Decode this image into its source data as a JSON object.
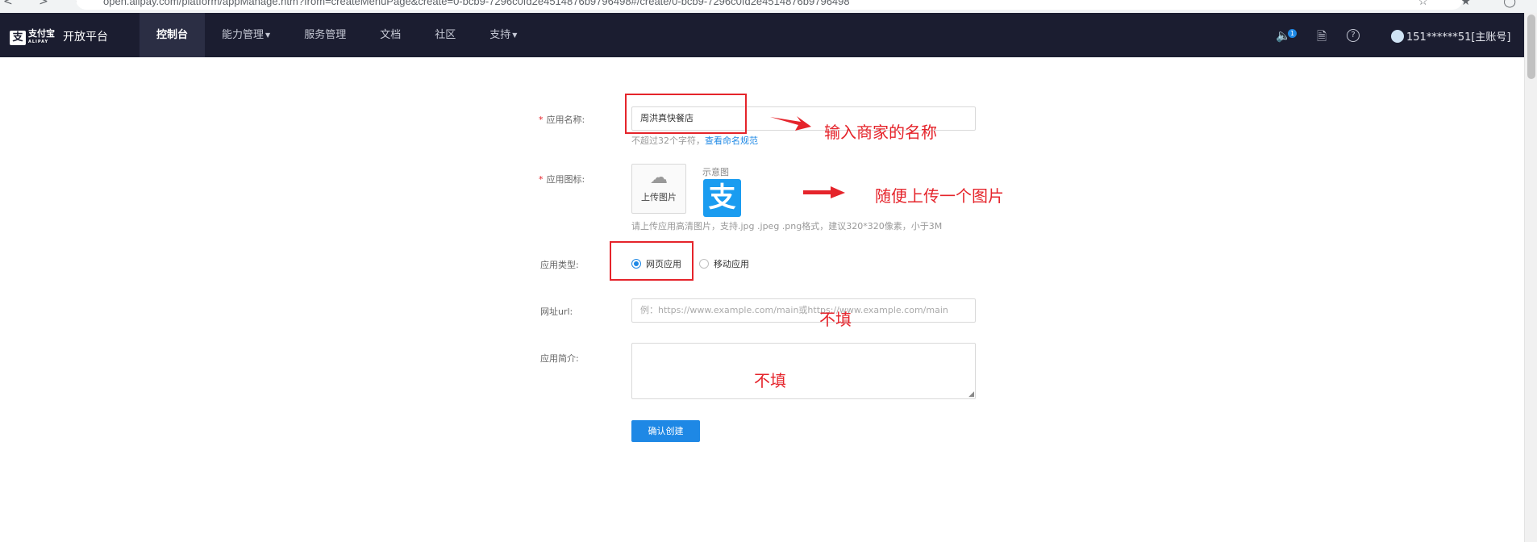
{
  "browser": {
    "url": "open.alipay.com/platform/appManage.htm?from=createMenuPage&create=0-bcb9-7296c0fd2e4514876b9796498#/create/0-bcb9-7296c0fd2e4514876b9796498"
  },
  "nav": {
    "logo_cn": "支付宝",
    "logo_en": "ALIPAY",
    "platform": "开放平台",
    "items": [
      {
        "label": "控制台",
        "active": true
      },
      {
        "label": "能力管理",
        "dropdown": true
      },
      {
        "label": "服务管理"
      },
      {
        "label": "文档"
      },
      {
        "label": "社区"
      },
      {
        "label": "支持",
        "dropdown": true
      }
    ],
    "notification_count": "1",
    "user": "151******51[主账号]",
    "icons": [
      "speaker-icon",
      "document-icon",
      "help-icon"
    ]
  },
  "form": {
    "app_name": {
      "label": "应用名称:",
      "value": "周洪真快餐店",
      "hint": "不超过32个字符，",
      "hint_link": "查看命名规范"
    },
    "app_icon": {
      "label": "应用图标:",
      "upload_label": "上传图片",
      "sample_label": "示意图",
      "sample_glyph": "支",
      "hint": "请上传应用高清图片，支持.jpg .jpeg .png格式，建议320*320像素，小于3M"
    },
    "app_type": {
      "label": "应用类型:",
      "options": [
        {
          "label": "网页应用",
          "checked": true
        },
        {
          "label": "移动应用",
          "checked": false
        }
      ]
    },
    "url": {
      "label": "网址url:",
      "placeholder": "例：https://www.example.com/main或https://www.example.com/main"
    },
    "description": {
      "label": "应用简介:"
    },
    "submit_label": "确认创建"
  },
  "annotations": {
    "name_note": "输入商家的名称",
    "icon_note": "随便上传一个图片",
    "url_note": "不填",
    "desc_note": "不填",
    "color": "#e5242b"
  },
  "colors": {
    "nav_bg": "#1b1d30",
    "accent": "#1e88e5",
    "required": "#e5242b"
  }
}
